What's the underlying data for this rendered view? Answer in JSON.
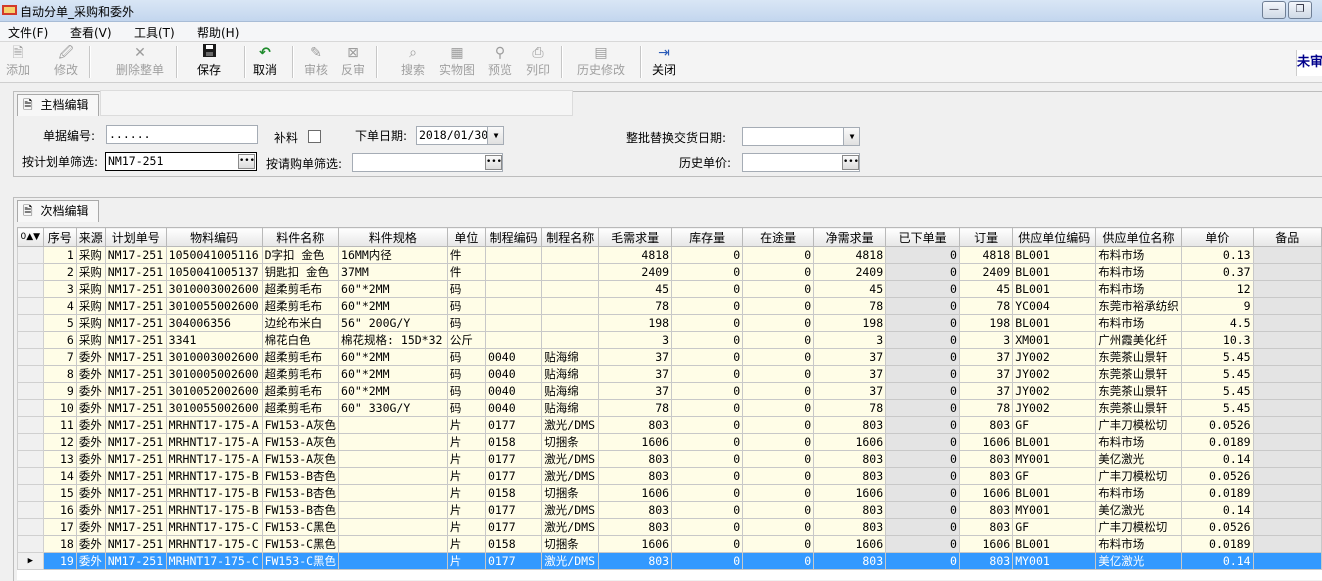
{
  "window": {
    "title": "自动分单_采购和委外",
    "minimize": "—",
    "restore": "❐"
  },
  "menu": [
    "文件(F)",
    "查看(V)",
    "工具(T)",
    "帮助(H)"
  ],
  "toolbar": {
    "add": "添加",
    "edit": "修改",
    "delete_all": "删除整单",
    "save": "保存",
    "cancel": "取消",
    "review": "审核",
    "unreview": "反审",
    "search": "搜索",
    "physical": "实物图",
    "preview": "预览",
    "print": "列印",
    "history_edit": "历史修改",
    "close": "关闭",
    "right_link": "未审"
  },
  "master": {
    "tab_label": "主档编辑",
    "doc_no_label": "单据编号:",
    "doc_no_value": "......",
    "supplement_label": "补料",
    "order_date_label": "下单日期:",
    "order_date_value": "2018/01/30",
    "batch_date_label": "整批替换交货日期:",
    "batch_date_value": "",
    "plan_filter_label": "按计划单筛选:",
    "plan_filter_value": "NM17-251",
    "request_filter_label": "按请购单筛选:",
    "request_filter_value": "",
    "history_price_label": "历史单价:",
    "history_price_value": ""
  },
  "detail": {
    "tab_label": "次档编辑",
    "columns": [
      "序号",
      "来源",
      "计划单号",
      "物料编码",
      "料件名称",
      "料件规格",
      "单位",
      "制程编码",
      "制程名称",
      "毛需求量",
      "库存量",
      "在途量",
      "净需求量",
      "已下单量",
      "订量",
      "供应单位编码",
      "供应单位名称",
      "单价",
      "备品"
    ],
    "rows": [
      [
        "1",
        "采购",
        "NM17-251",
        "1050041005116",
        "D字扣 金色",
        "16MM内径",
        "件",
        "",
        "",
        "4818",
        "0",
        "0",
        "4818",
        "0",
        "4818",
        "BL001",
        "布料市场",
        "0.13",
        ""
      ],
      [
        "2",
        "采购",
        "NM17-251",
        "1050041005137",
        "钥匙扣 金色",
        "37MM",
        "件",
        "",
        "",
        "2409",
        "0",
        "0",
        "2409",
        "0",
        "2409",
        "BL001",
        "布料市场",
        "0.37",
        ""
      ],
      [
        "3",
        "采购",
        "NM17-251",
        "3010003002600",
        "超柔剪毛布",
        "60\"*2MM",
        "码",
        "",
        "",
        "45",
        "0",
        "0",
        "45",
        "0",
        "45",
        "BL001",
        "布料市场",
        "12",
        ""
      ],
      [
        "4",
        "采购",
        "NM17-251",
        "3010055002600",
        "超柔剪毛布",
        "60\"*2MM",
        "码",
        "",
        "",
        "78",
        "0",
        "0",
        "78",
        "0",
        "78",
        "YC004",
        "东莞市裕承纺织",
        "9",
        ""
      ],
      [
        "5",
        "采购",
        "NM17-251",
        "304006356",
        "边纶布米白",
        "56\" 200G/Y",
        "码",
        "",
        "",
        "198",
        "0",
        "0",
        "198",
        "0",
        "198",
        "BL001",
        "布料市场",
        "4.5",
        ""
      ],
      [
        "6",
        "采购",
        "NM17-251",
        "3341",
        "棉花白色",
        "棉花规格: 15D*32",
        "公斤",
        "",
        "",
        "3",
        "0",
        "0",
        "3",
        "0",
        "3",
        "XM001",
        "广州霞美化纤",
        "10.3",
        ""
      ],
      [
        "7",
        "委外",
        "NM17-251",
        "3010003002600",
        "超柔剪毛布",
        "60\"*2MM",
        "码",
        "0040",
        "贴海绵",
        "37",
        "0",
        "0",
        "37",
        "0",
        "37",
        "JY002",
        "东莞茶山景轩",
        "5.45",
        ""
      ],
      [
        "8",
        "委外",
        "NM17-251",
        "3010005002600",
        "超柔剪毛布",
        "60\"*2MM",
        "码",
        "0040",
        "贴海绵",
        "37",
        "0",
        "0",
        "37",
        "0",
        "37",
        "JY002",
        "东莞茶山景轩",
        "5.45",
        ""
      ],
      [
        "9",
        "委外",
        "NM17-251",
        "3010052002600",
        "超柔剪毛布",
        "60\"*2MM",
        "码",
        "0040",
        "贴海绵",
        "37",
        "0",
        "0",
        "37",
        "0",
        "37",
        "JY002",
        "东莞茶山景轩",
        "5.45",
        ""
      ],
      [
        "10",
        "委外",
        "NM17-251",
        "3010055002600",
        "超柔剪毛布",
        "60\" 330G/Y",
        "码",
        "0040",
        "贴海绵",
        "78",
        "0",
        "0",
        "78",
        "0",
        "78",
        "JY002",
        "东莞茶山景轩",
        "5.45",
        ""
      ],
      [
        "11",
        "委外",
        "NM17-251",
        "MRHNT17-175-A",
        "FW153-A灰色",
        "",
        "片",
        "0177",
        "激光/DMS",
        "803",
        "0",
        "0",
        "803",
        "0",
        "803",
        "GF",
        "广丰刀模松切",
        "0.0526",
        ""
      ],
      [
        "12",
        "委外",
        "NM17-251",
        "MRHNT17-175-A",
        "FW153-A灰色",
        "",
        "片",
        "0158",
        "切捆条",
        "1606",
        "0",
        "0",
        "1606",
        "0",
        "1606",
        "BL001",
        "布料市场",
        "0.0189",
        ""
      ],
      [
        "13",
        "委外",
        "NM17-251",
        "MRHNT17-175-A",
        "FW153-A灰色",
        "",
        "片",
        "0177",
        "激光/DMS",
        "803",
        "0",
        "0",
        "803",
        "0",
        "803",
        "MY001",
        "美亿激光",
        "0.14",
        ""
      ],
      [
        "14",
        "委外",
        "NM17-251",
        "MRHNT17-175-B",
        "FW153-B杏色",
        "",
        "片",
        "0177",
        "激光/DMS",
        "803",
        "0",
        "0",
        "803",
        "0",
        "803",
        "GF",
        "广丰刀模松切",
        "0.0526",
        ""
      ],
      [
        "15",
        "委外",
        "NM17-251",
        "MRHNT17-175-B",
        "FW153-B杏色",
        "",
        "片",
        "0158",
        "切捆条",
        "1606",
        "0",
        "0",
        "1606",
        "0",
        "1606",
        "BL001",
        "布料市场",
        "0.0189",
        ""
      ],
      [
        "16",
        "委外",
        "NM17-251",
        "MRHNT17-175-B",
        "FW153-B杏色",
        "",
        "片",
        "0177",
        "激光/DMS",
        "803",
        "0",
        "0",
        "803",
        "0",
        "803",
        "MY001",
        "美亿激光",
        "0.14",
        ""
      ],
      [
        "17",
        "委外",
        "NM17-251",
        "MRHNT17-175-C",
        "FW153-C黑色",
        "",
        "片",
        "0177",
        "激光/DMS",
        "803",
        "0",
        "0",
        "803",
        "0",
        "803",
        "GF",
        "广丰刀模松切",
        "0.0526",
        ""
      ],
      [
        "18",
        "委外",
        "NM17-251",
        "MRHNT17-175-C",
        "FW153-C黑色",
        "",
        "片",
        "0158",
        "切捆条",
        "1606",
        "0",
        "0",
        "1606",
        "0",
        "1606",
        "BL001",
        "布料市场",
        "0.0189",
        ""
      ],
      [
        "19",
        "委外",
        "NM17-251",
        "MRHNT17-175-C",
        "FW153-C黑色",
        "",
        "片",
        "0177",
        "激光/DMS",
        "803",
        "0",
        "0",
        "803",
        "0",
        "803",
        "MY001",
        "美亿激光",
        "0.14",
        ""
      ]
    ],
    "selected_row": 19
  },
  "colors": {
    "selection": "#3399ff",
    "cell_bg": "#fffde7",
    "gray_cell": "#e4e4e4"
  }
}
